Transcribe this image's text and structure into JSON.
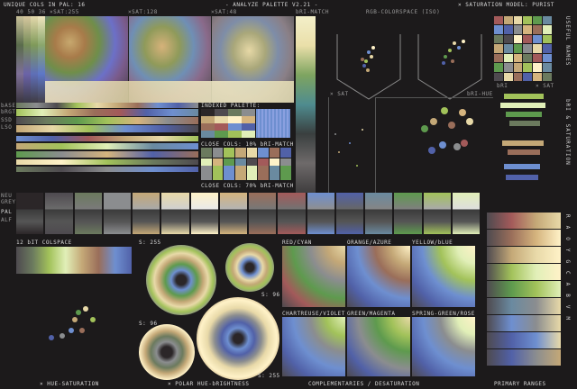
{
  "header": {
    "unique_cols": "UNIQUE COLS IN PAL: 16",
    "title": "- ANALYZE PALETTE V2.21 -",
    "model": "× SATURATION MODEL: PURIST"
  },
  "top_labels": {
    "sat_values": "40 50 36 ×SAT:255",
    "sat128": "×SAT:128",
    "sat48": "×SAT:48",
    "bri_match": "bRI-MATCH",
    "rgb_colorspace": "RGB-COLORSPACE (ISO)",
    "sat_small": "× SAT",
    "bri_hue": "bRI-HUE",
    "bri": "bRI",
    "sat_right": "× SAT"
  },
  "side_labels": {
    "left_rows": [
      "bASE",
      "bRGT",
      "SSD",
      "LSO"
    ],
    "grey_rows": [
      "NEU",
      "GREY",
      "PAL",
      "ALF"
    ],
    "useful_names": "USEFUL NAMES",
    "bri_saturation": "bRI & SATURATION",
    "ramp_letters": "RAOYGCABVM"
  },
  "middle_labels": {
    "indexed_palette": "INDEXED PALETTE:",
    "close_cols_10": "CLOSE COLS: 10% bRI-MATCH",
    "close_cols_70": "CLOSE COLS: 70% bRI-MATCH",
    "bit_colspace": "12 bIT COLSPACE",
    "s255_top": "S: 255",
    "s96_mid": "S: 96",
    "s96_left": "S: 96",
    "s255_bottom": "S: 255",
    "red_cyan": "RED/CYAN",
    "orange_azure": "ORANGE/AZURE",
    "yellow_blue": "YELLOW/bLUE",
    "chartreuse_violet": "CHARTREUSE/VIOLET",
    "green_magenta": "GREEN/MAGENTA",
    "spring_rose": "SPRING-GREEN/ROSE"
  },
  "footer": {
    "hue_sat": "× HUE-SATURATION",
    "polar": "× POLAR HUE-bRIGHTNESS",
    "complementaries": "COMPLEMENTARIES / DESATURATION",
    "primary_ranges": "PRIMARY RANGES"
  },
  "colors": {
    "bg": "#1c1a1b",
    "palette": [
      "#2b2628",
      "#4e4a4f",
      "#6b7a5e",
      "#8b8d8f",
      "#c4a877",
      "#e8d9a8",
      "#fff2c8",
      "#d5b47e",
      "#9a6e5a",
      "#a35a5a",
      "#6e8fd0",
      "#5161a8",
      "#6a8aa0",
      "#5e9a4e",
      "#a2c25a",
      "#e1efb8"
    ]
  }
}
